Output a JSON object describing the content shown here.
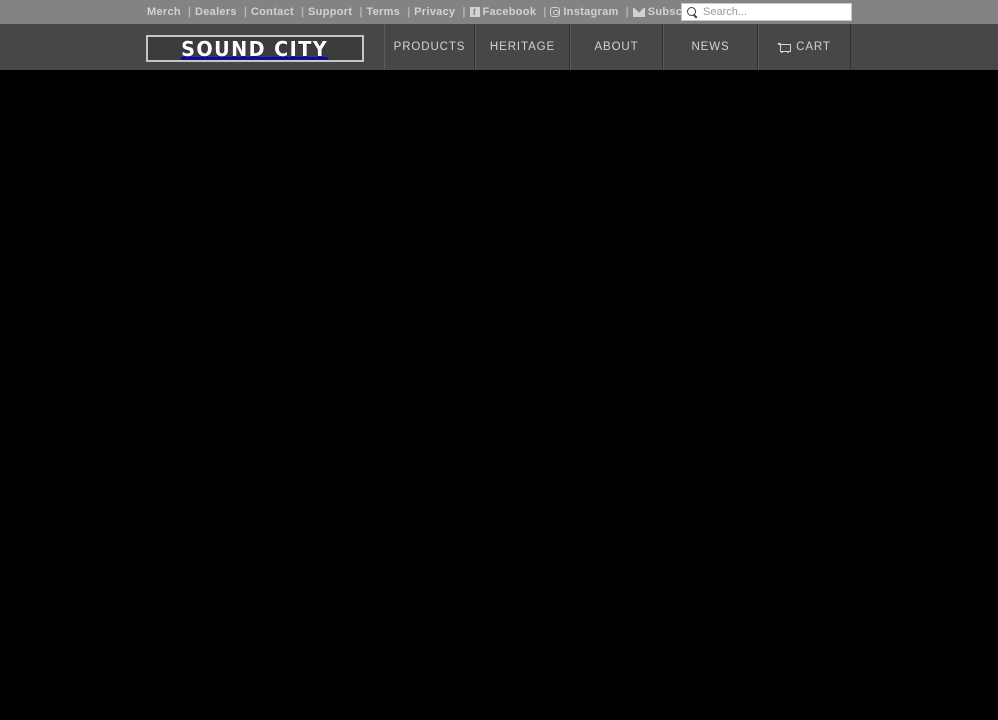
{
  "topbar": {
    "links": [
      {
        "label": "Merch",
        "icon": null,
        "separator": false
      },
      {
        "label": "Dealers",
        "icon": null,
        "separator": true
      },
      {
        "label": "Contact",
        "icon": null,
        "separator": true
      },
      {
        "label": "Support",
        "icon": null,
        "separator": true
      },
      {
        "label": "Terms",
        "icon": null,
        "separator": true
      },
      {
        "label": "Privacy",
        "icon": null,
        "separator": true
      },
      {
        "label": "Facebook",
        "icon": "facebook-icon",
        "separator": true
      },
      {
        "label": "Instagram",
        "icon": "instagram-icon",
        "separator": true
      },
      {
        "label": "Subscribe",
        "icon": "envelope-icon",
        "separator": true
      }
    ],
    "separator_char": "|",
    "facebook_glyph": "f"
  },
  "search": {
    "placeholder": "Search...",
    "value": "",
    "icon": "search-icon"
  },
  "brand": {
    "logo_text": "SOUND CITY"
  },
  "nav": {
    "items": [
      {
        "label": "PRODUCTS",
        "icon": null
      },
      {
        "label": "HERITAGE",
        "icon": null
      },
      {
        "label": "ABOUT",
        "icon": null
      },
      {
        "label": "NEWS",
        "icon": null
      },
      {
        "label": "CART",
        "icon": "cart-icon"
      }
    ]
  },
  "colors": {
    "topbar_bg": "#838383",
    "navbar_bg": "#474747",
    "body_bg": "#000000",
    "text_light": "#d3d3d3",
    "logo_border": "#c5c5c5"
  }
}
